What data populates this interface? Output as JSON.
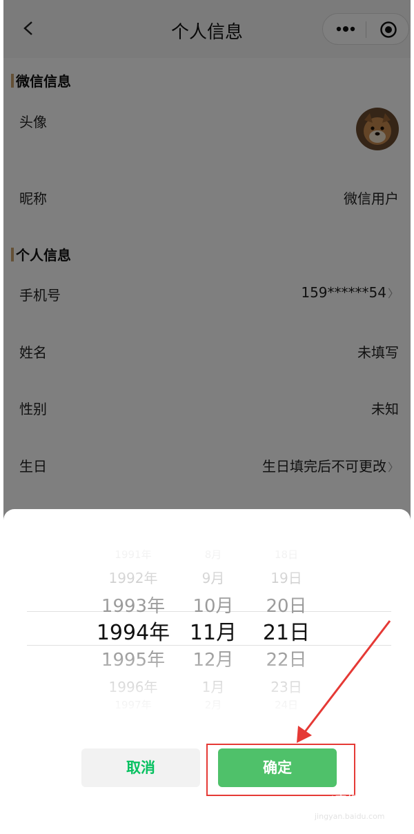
{
  "nav": {
    "title": "个人信息",
    "back_icon": "chevron-left-icon",
    "more_icon": "more-dots-icon",
    "target_icon": "target-icon"
  },
  "sections": {
    "wechat_title": "微信信息",
    "personal_title": "个人信息"
  },
  "rows": {
    "avatar_label": "头像",
    "nickname_label": "昵称",
    "nickname_value": "微信用户",
    "phone_label": "手机号",
    "phone_value": "159******54",
    "name_label": "姓名",
    "name_value": "未填写",
    "gender_label": "性别",
    "gender_value": "未知",
    "birthday_label": "生日",
    "birthday_value": "生日填完后不可更改"
  },
  "picker": {
    "years": [
      "1991年",
      "1992年",
      "1993年",
      "1994年",
      "1995年",
      "1996年",
      "1997年"
    ],
    "months": [
      "8月",
      "9月",
      "10月",
      "11月",
      "12月",
      "1月",
      "2月"
    ],
    "days": [
      "18日",
      "19日",
      "20日",
      "21日",
      "22日",
      "23日",
      "24日"
    ],
    "selected_index": 3
  },
  "buttons": {
    "cancel": "取消",
    "confirm": "确定"
  },
  "watermark": {
    "main": "Bai度经验",
    "sub": "jingyan.baidu.com"
  },
  "colors": {
    "accent_green": "#4fc16a",
    "cancel_text_green": "#07c160",
    "highlight_red": "#e53935",
    "section_bar": "#c9a06a"
  }
}
